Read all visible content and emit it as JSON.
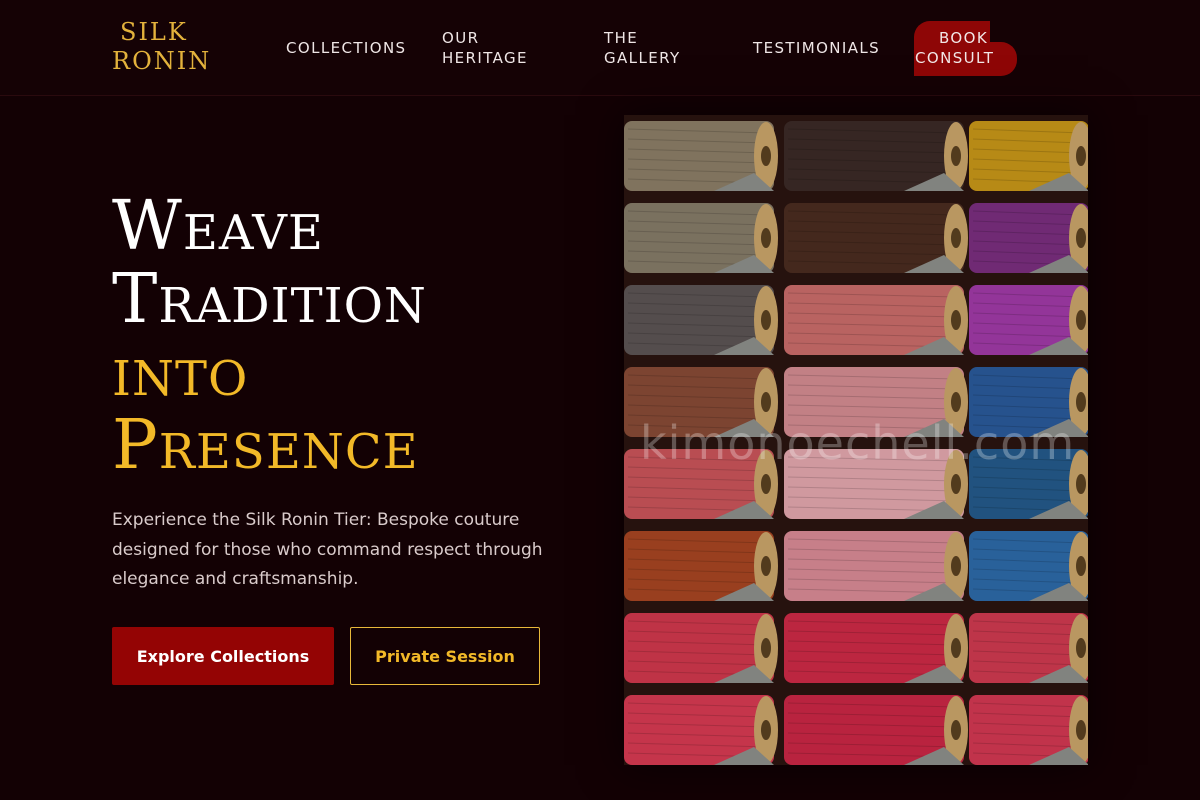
{
  "brand": {
    "line1": "SILK",
    "line2": "RONIN"
  },
  "nav": {
    "collections": [
      "COLLECTIONS"
    ],
    "heritage": [
      "OUR",
      "HERITAGE"
    ],
    "gallery": [
      "THE",
      "GALLERY"
    ],
    "testimonials": [
      "TESTIMONIALS"
    ],
    "book": [
      "BOOK",
      "CONSULT"
    ]
  },
  "hero": {
    "title_lines": [
      "Weave",
      "Tradition",
      "into",
      "Presence"
    ],
    "description": "Experience the Silk Ronin Tier: Bespoke couture designed for those who command respect through elegance and craftsmanship.",
    "primary_button": "Explore Collections",
    "secondary_button": "Private Session"
  },
  "image": {
    "subject": "thread spools",
    "watermark": "kimonoechell.com"
  },
  "colors": {
    "background": "#130104",
    "accent_gold": "#f2b928",
    "accent_red": "#940404"
  }
}
